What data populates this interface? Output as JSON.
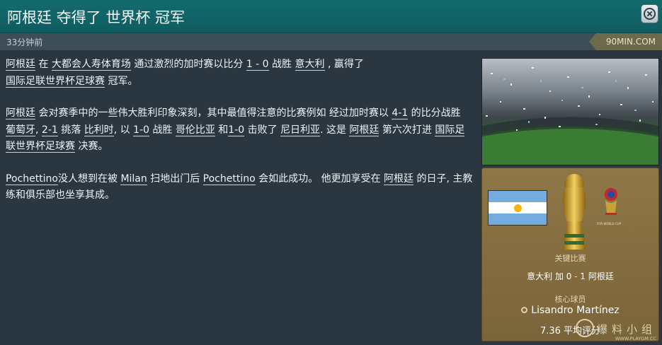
{
  "window": {
    "title": "阿根廷 夺得了 世界杯 冠军",
    "close_icon": "close-icon"
  },
  "meta": {
    "time_ago": "33分钟前",
    "source": "90MIN.COM"
  },
  "article": {
    "p1": {
      "s1": "阿根廷",
      "s2": " 在 ",
      "s3": "大都会人寿体育场",
      "s4": " 通过激烈的加时赛以比分 ",
      "s5": "1 - 0",
      "s6": " 战胜 ",
      "s7": "意大利",
      "s8": " , 赢得了",
      "s9": "国际足联世界杯足球赛",
      "s10": " 冠军。"
    },
    "p2": {
      "s1": "阿根廷",
      "s2": " 会对赛季中的一些伟大胜利印象深刻，其中最值得注意的比赛例如 经过加时赛以 ",
      "s3": "4-1",
      "s4": " 的比分战胜 ",
      "s5": "葡萄牙",
      "s6": ", ",
      "s7": "2-1",
      "s8": " 挑落 ",
      "s9": "比利时",
      "s10": ", 以 ",
      "s11": "1-0",
      "s12": " 战胜 ",
      "s13": "哥伦比亚",
      "s14": " 和",
      "s15": "1-0",
      "s16": " 击败了 ",
      "s17": "尼日利亚",
      "s18": ". 这是 ",
      "s19": "阿根廷",
      "s20": " 第六次打进 ",
      "s21": "国际足联世界杯足球赛",
      "s22": " 决赛。"
    },
    "p3": {
      "s1": "Pochettino",
      "s2": "没人想到在被 ",
      "s3": "Milan",
      "s4": " 扫地出门后 ",
      "s5": "Pochettino",
      "s6": " 会如此成功。 他更加享受在 ",
      "s7": "阿根廷",
      "s8": " 的日子, 主教练和俱乐部也坐享其成。"
    }
  },
  "card": {
    "key_match_label": "关键比赛",
    "key_match_value": "意大利 加 0 - 1 阿根廷",
    "key_player_label": "核心球员",
    "key_player_name": "Lisandro Martínez",
    "rating": "7.36 平均评分",
    "flag": "argentina-flag",
    "trophy": "world-cup-trophy",
    "logo": "fifa-world-cup-logo",
    "logo_text": "FIFA WORLD CUP",
    "player_icon": "person-icon"
  },
  "watermark": {
    "text": "爆料小组",
    "url": "WWW.PLAYGM.CC"
  }
}
